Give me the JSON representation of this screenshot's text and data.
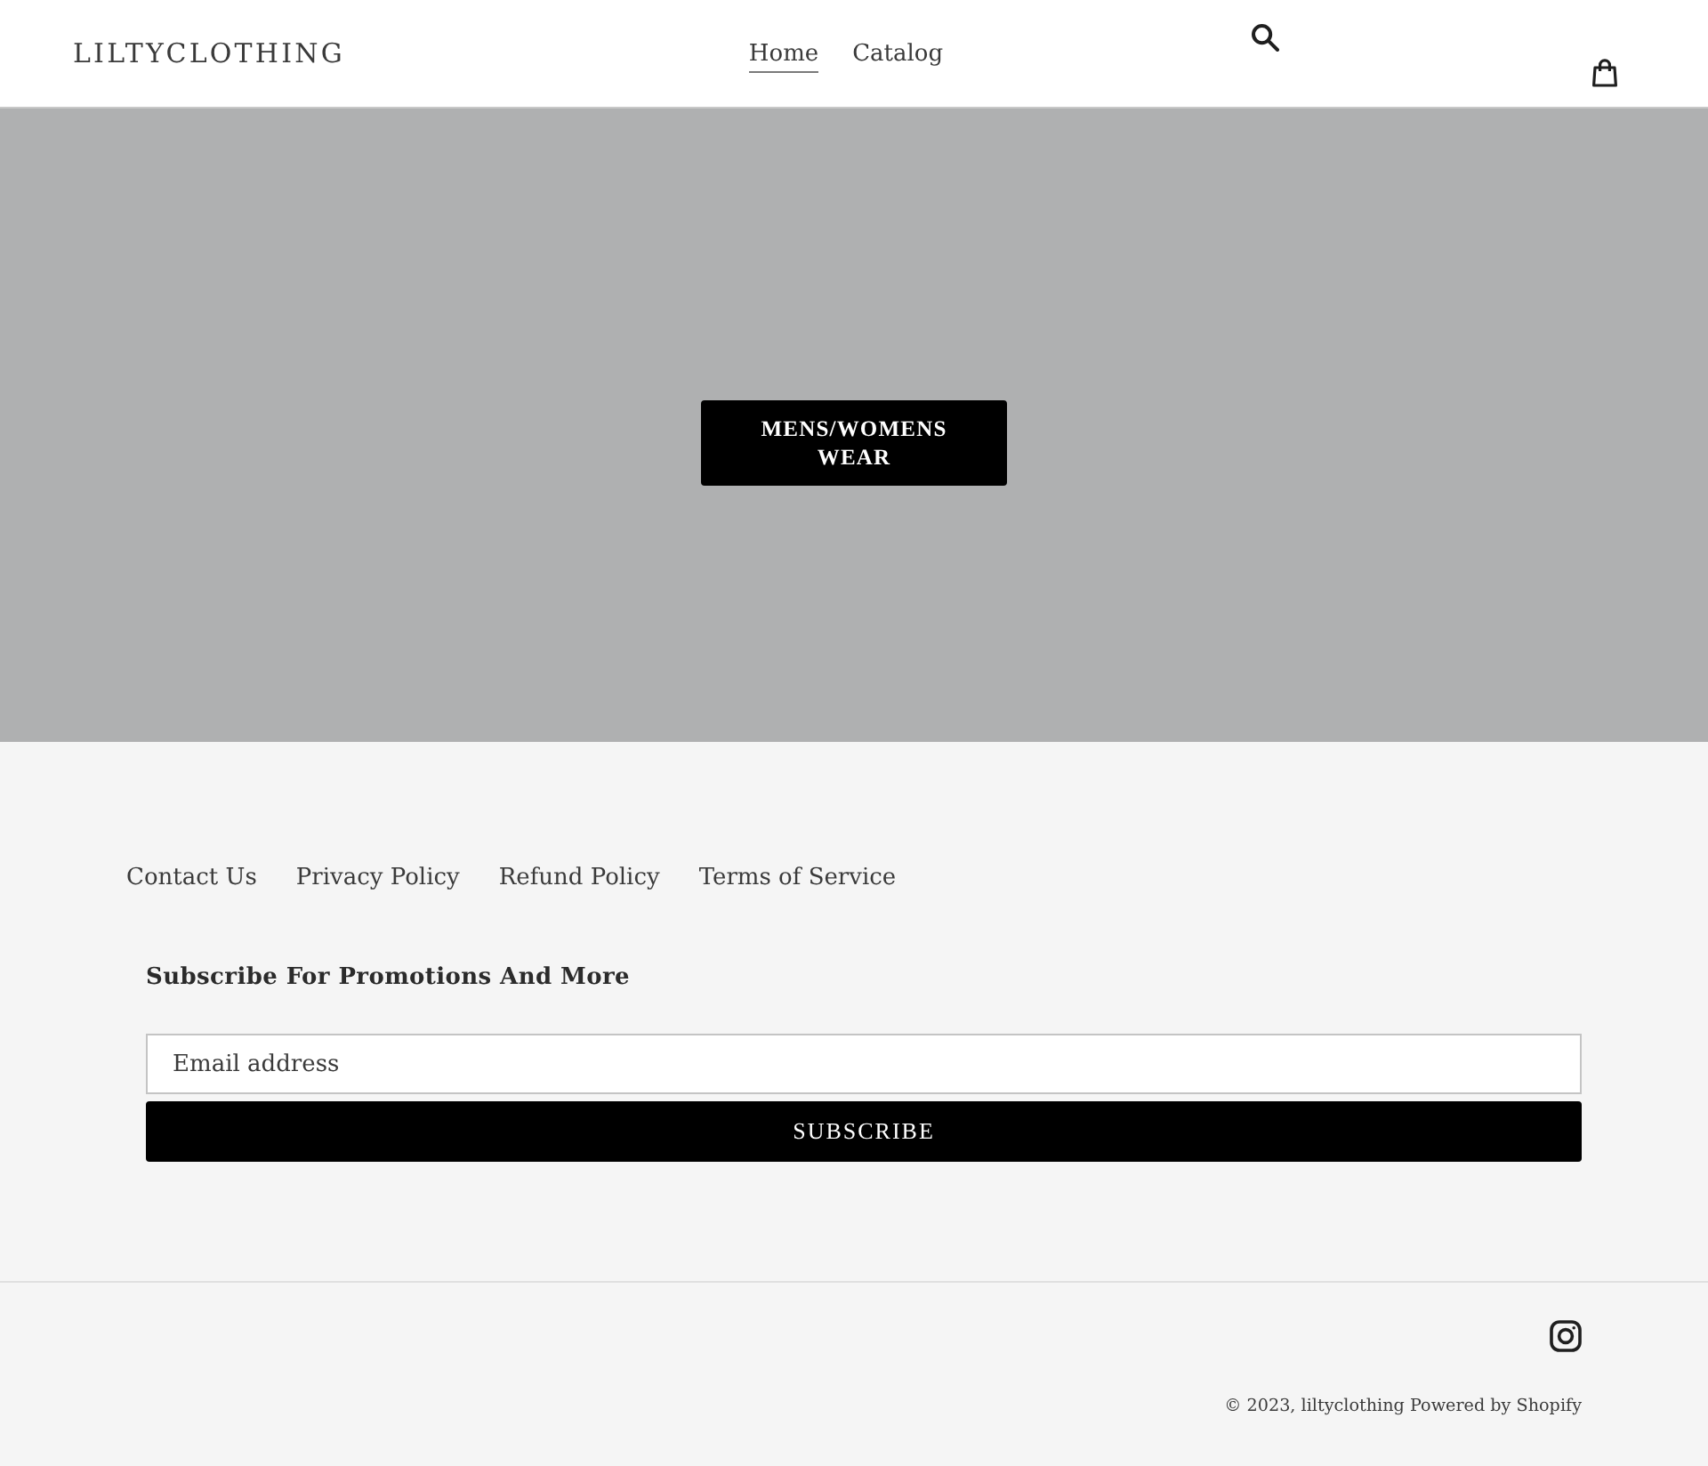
{
  "header": {
    "logo": "LILTYCLOTHING",
    "nav": [
      {
        "label": "Home",
        "selected": true
      },
      {
        "label": "Catalog",
        "selected": false
      }
    ]
  },
  "hero": {
    "button": "MENS/WOMENS WEAR"
  },
  "footer": {
    "links": [
      "Contact Us",
      "Privacy Policy",
      "Refund Policy",
      "Terms of Service"
    ],
    "newsletter": {
      "heading": "Subscribe For Promotions And More",
      "placeholder": "Email address",
      "button": "SUBSCRIBE"
    },
    "copyright": {
      "text": "© 2023,",
      "store_link": "liltyclothing",
      "powered_by": "Powered by Shopify"
    }
  }
}
